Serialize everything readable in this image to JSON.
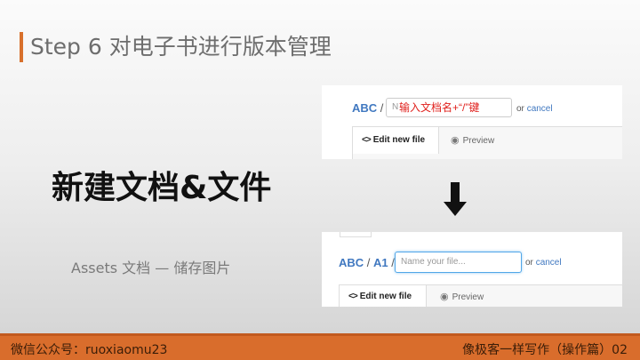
{
  "slide": {
    "title": "Step 6 对电子书进行版本管理",
    "heading": "新建文档&文件",
    "subtitle": "Assets 文档 — 储存图片"
  },
  "screenshot_top": {
    "repo": "ABC",
    "separator": "/",
    "input_placeholder": "N",
    "annotation": "输入文档名+“/”键",
    "or_text": "or",
    "cancel_label": "cancel",
    "tab_edit": "Edit new file",
    "tab_preview": "Preview"
  },
  "screenshot_bottom": {
    "repo": "ABC",
    "separator1": "/",
    "folder": "A1",
    "separator2": "/",
    "input_placeholder": "Name your file...",
    "or_text": "or",
    "cancel_label": "cancel",
    "tab_edit": "Edit new file",
    "tab_preview": "Preview"
  },
  "footer": {
    "left": "微信公众号：ruoxiaomu23",
    "right": "像极客一样写作（操作篇）02"
  },
  "colors": {
    "accent": "#d96d2c",
    "link": "#4078c0",
    "annotation": "#e0201c"
  },
  "icons": {
    "arrow": "down-arrow-icon",
    "code": "code-icon",
    "eye": "eye-icon"
  }
}
